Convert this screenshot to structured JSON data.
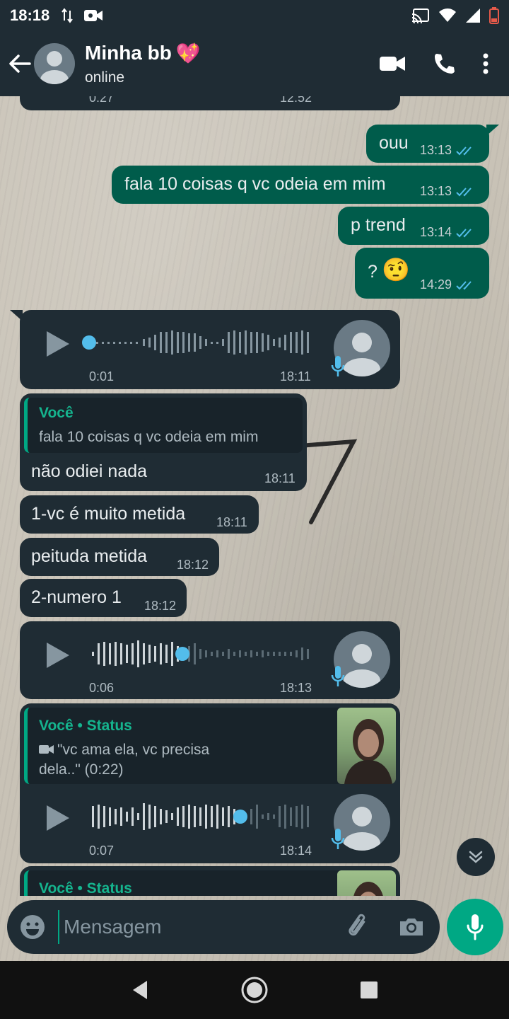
{
  "status_bar": {
    "time": "18:18"
  },
  "header": {
    "contact_name": "Minha bb",
    "contact_emoji": "💖",
    "contact_status": "online"
  },
  "messages": {
    "clipped_top": {
      "duration": "0:27",
      "time": "12:52"
    },
    "m1": {
      "text": "ouu",
      "time": "13:13"
    },
    "m2": {
      "text": "fala 10 coisas q vc odeia em mim",
      "time": "13:13"
    },
    "m3": {
      "text": "p trend",
      "time": "13:14"
    },
    "m4": {
      "text": "?",
      "emoji": "🤨",
      "time": "14:29"
    },
    "voice1": {
      "duration": "0:01",
      "time": "18:11"
    },
    "reply1": {
      "quote_author": "Você",
      "quote_text": "fala 10 coisas q vc odeia em mim",
      "text": "não odiei nada",
      "time": "18:11"
    },
    "m5": {
      "text": "1-vc é muito metida",
      "time": "18:11"
    },
    "m6": {
      "text": "peituda metida",
      "time": "18:12"
    },
    "m7": {
      "text": "2-numero 1",
      "time": "18:12"
    },
    "voice2": {
      "duration": "0:06",
      "time": "18:13"
    },
    "status_reply": {
      "quote_author": "Você • Status",
      "quote_text_line1": "\"vc ama ela, vc precisa",
      "quote_text_line2": "dela..\" (0:22)",
      "duration": "0:07",
      "time": "18:14"
    },
    "status_reply2": {
      "quote_author": "Você • Status"
    }
  },
  "input": {
    "placeholder": "Mensagem"
  },
  "colors": {
    "bar": "#1f2c34",
    "outgoing": "#005c4b",
    "incoming": "#1f2c34",
    "accent": "#00a884",
    "tick_read": "#53bdeb"
  }
}
